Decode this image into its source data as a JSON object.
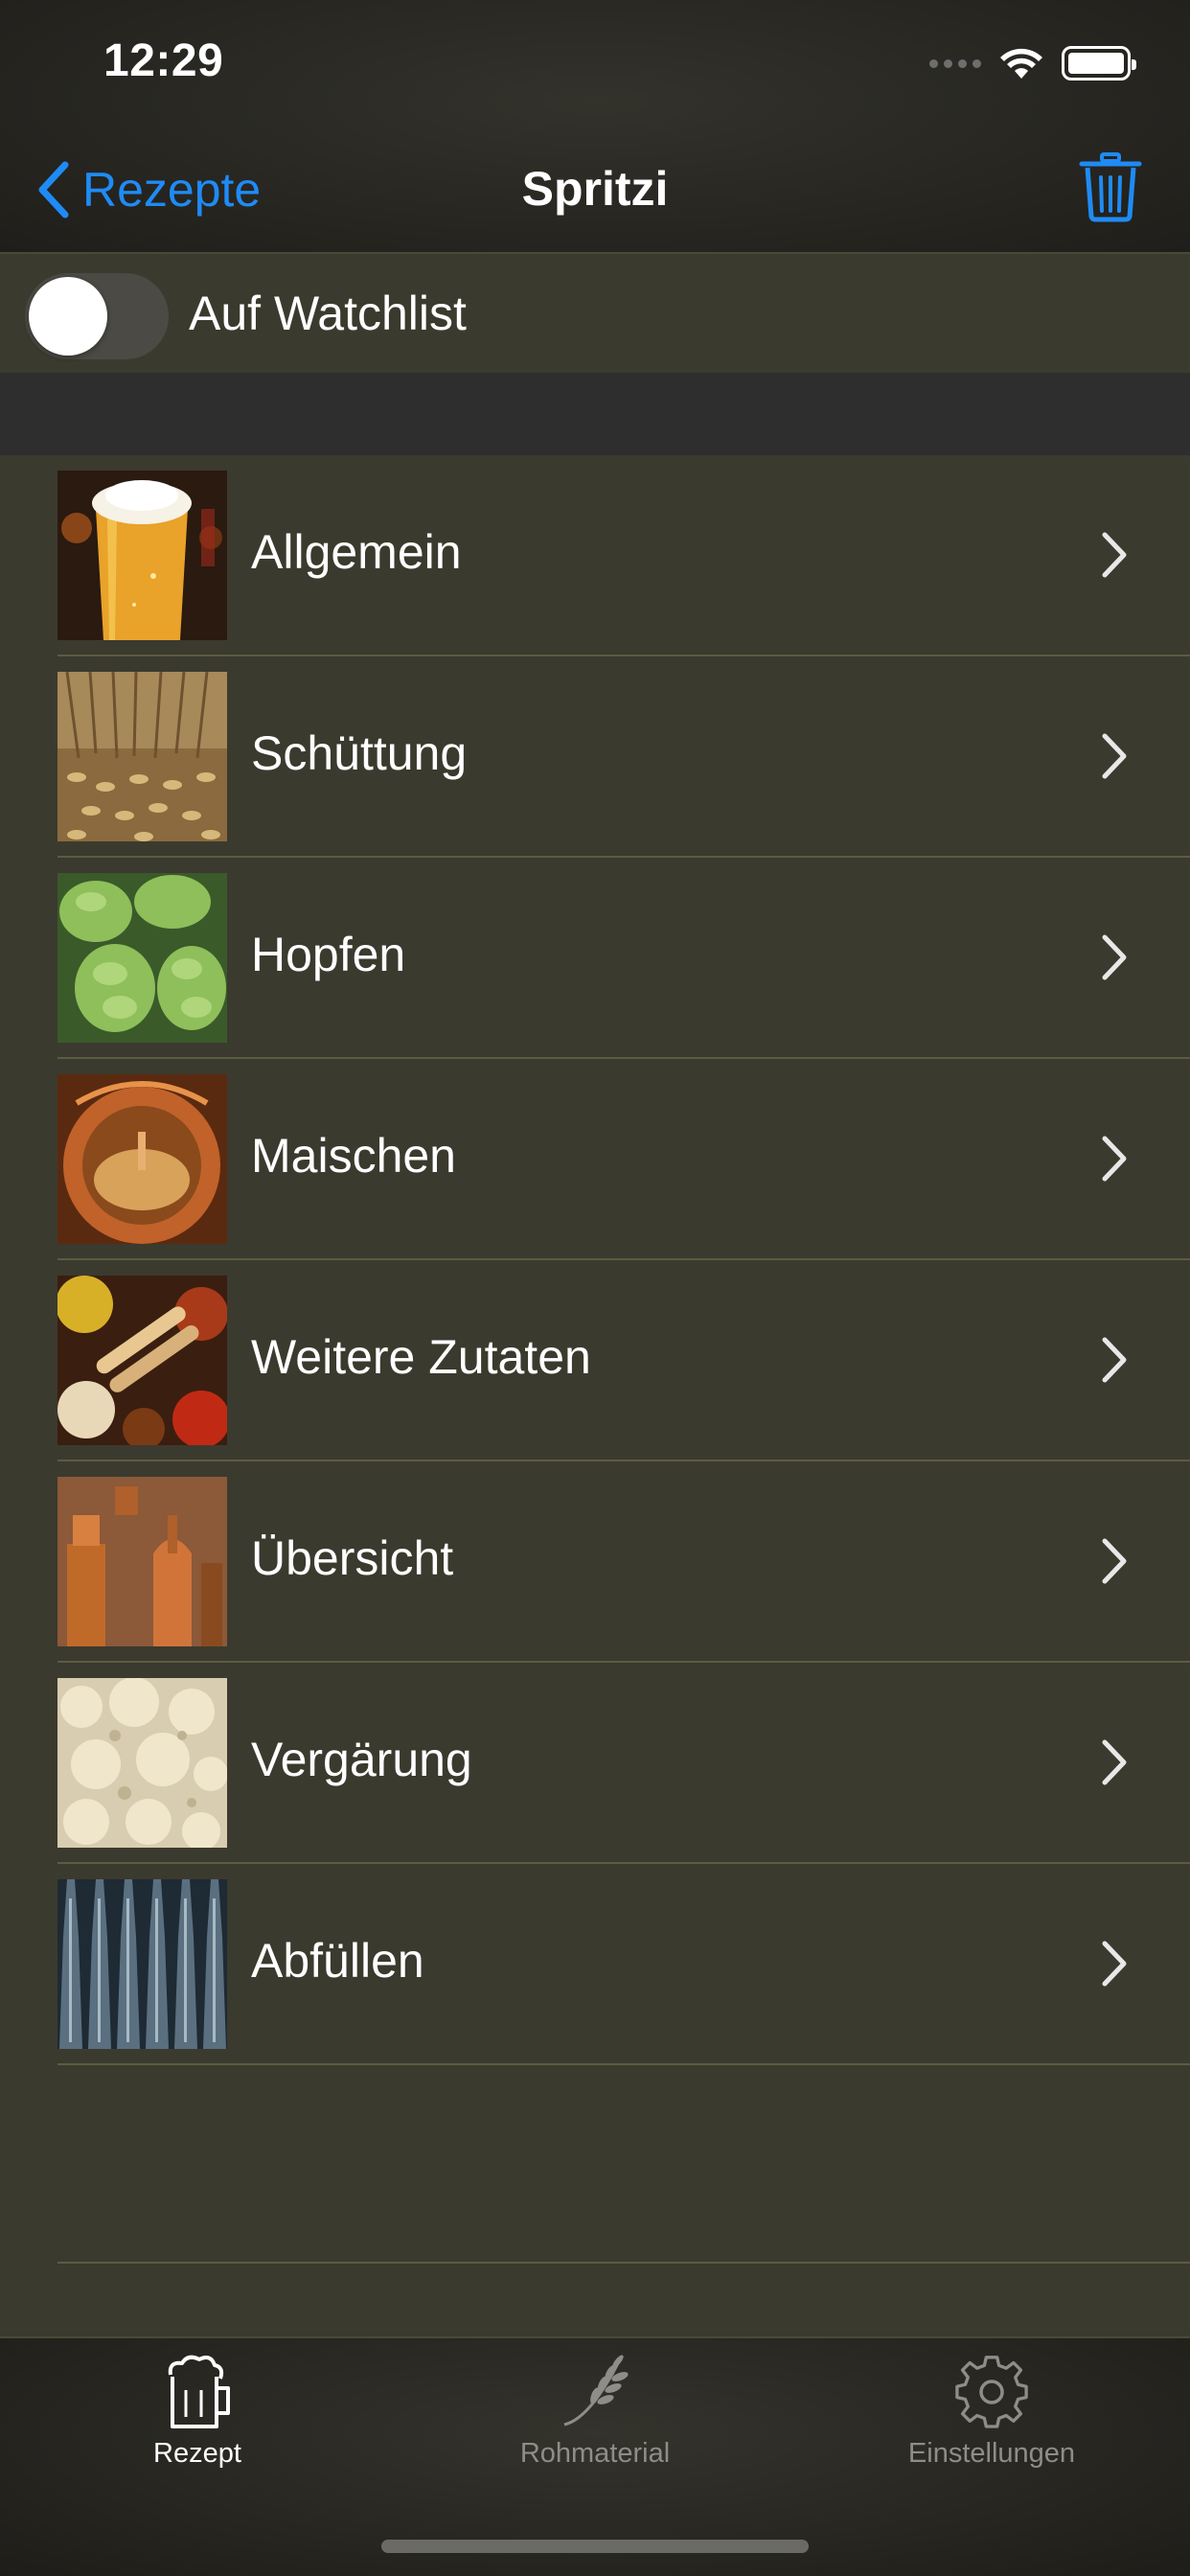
{
  "status_bar": {
    "time": "12:29"
  },
  "nav": {
    "back_label": "Rezepte",
    "title": "Spritzi"
  },
  "watchlist": {
    "label": "Auf Watchlist",
    "enabled": false
  },
  "sections": [
    {
      "label": "Allgemein"
    },
    {
      "label": "Schüttung"
    },
    {
      "label": "Hopfen"
    },
    {
      "label": "Maischen"
    },
    {
      "label": "Weitere Zutaten"
    },
    {
      "label": "Übersicht"
    },
    {
      "label": "Vergärung"
    },
    {
      "label": "Abfüllen"
    }
  ],
  "tabbar": {
    "items": [
      {
        "label": "Rezept",
        "active": true
      },
      {
        "label": "Rohmaterial",
        "active": false
      },
      {
        "label": "Einstellungen",
        "active": false
      }
    ]
  },
  "colors": {
    "accent": "#1f8bf5",
    "list_background": "#3b3a2e",
    "separator": "#5d5c40"
  }
}
